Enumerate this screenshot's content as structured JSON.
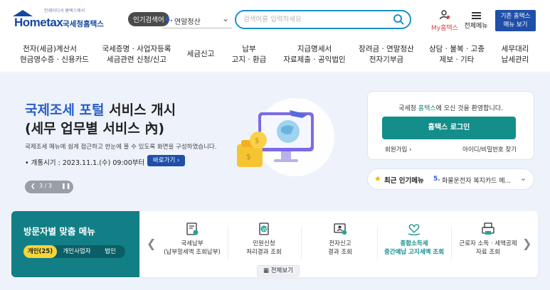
{
  "header": {
    "logo_small": "언제어디서 홈택스에서",
    "logo_word": "Hometax",
    "logo_kor": "국세청홈택스",
    "popular_badge": "인기검색어",
    "popular_num": "4.",
    "popular_term": "연말정산",
    "search_placeholder": "검색어를 입력하세요",
    "my_hometax": "My홈택스",
    "all_menu": "전체메뉴",
    "legacy_line1": "기존 홈택스",
    "legacy_line2": "메뉴 보기"
  },
  "nav": [
    {
      "l1": "전자(세금)계산서",
      "l2": "현금영수증 · 신용카드"
    },
    {
      "l1": "국세증명 · 사업자등록",
      "l2": "세금관련 신청/신고"
    },
    {
      "l1": "세금신고",
      "l2": ""
    },
    {
      "l1": "납부",
      "l2": "고지 · 환급"
    },
    {
      "l1": "지급명세서",
      "l2": "자료제출 · 공익법인"
    },
    {
      "l1": "장려금 · 연말정산",
      "l2": "전자기부금"
    },
    {
      "l1": "상담 · 불복 · 고충",
      "l2": "제보 · 기타"
    },
    {
      "l1": "세무대리",
      "l2": "납세관리"
    }
  ],
  "hero": {
    "title_accent": "국제조세 포털",
    "title_rest": " 서비스 개시",
    "subtitle": "(세무 업무별 서비스 內)",
    "desc": "국제조세 메뉴에 쉽게 접근하고 한눈에 볼 수 있도록 화면을 구성하였습니다.",
    "date": "• 개통시기 : 2023.11.1.(수) 09:00부터",
    "go_label": "바로가기",
    "pager_current": "3",
    "pager_total": "3",
    "pager_text": "3 / 3"
  },
  "login": {
    "welcome_pre": "국세청 ",
    "welcome_hl": "홈택스",
    "welcome_post": "에 오신 것을 환영합니다.",
    "login_button": "홈택스 로그인",
    "signup": "회원가입",
    "find_id": "아이디/비밀번호 찾기"
  },
  "popular_menu": {
    "label": "최근 인기메뉴",
    "num": "5.",
    "item": "화물운전자 복지카드 메..."
  },
  "visitor": {
    "title": "방문자별 맞춤 메뉴",
    "tabs": [
      "개인(25)",
      "개인사업자",
      "법인"
    ],
    "active_tab": 0
  },
  "quick_menu": [
    {
      "t1": "국세납부",
      "t2": "(납부할세액 조회납부)",
      "icon": "receipt-icon"
    },
    {
      "t1": "민원신청",
      "t2": "처리결과 조회",
      "icon": "won-document-icon"
    },
    {
      "t1": "전자신고",
      "t2": "결과 조회",
      "icon": "person-monitor-icon"
    },
    {
      "t1": "종합소득세",
      "t2": "중간예납 고지세액 조회",
      "icon": "heart-hands-icon",
      "highlight": true
    },
    {
      "t1": "근로자 소득 · 세액공제",
      "t2": "자료 조회",
      "icon": "printer-icon"
    }
  ],
  "more_label": "전체보기",
  "colors": {
    "brand_blue": "#1f4fa8",
    "teal": "#138e8a",
    "visitor_bg": "#127f86",
    "hero_bg": "#eef3fb",
    "accent_yellow": "#f6d53a"
  }
}
